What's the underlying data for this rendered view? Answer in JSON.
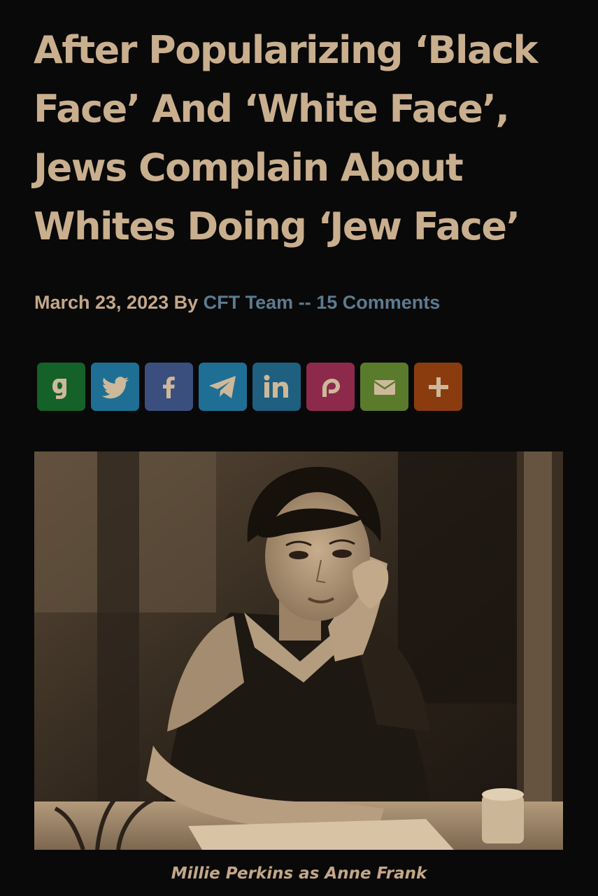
{
  "article": {
    "title": "After Popularizing ‘Black Face’ And ‘White Face’, Jews Complain About Whites Doing ‘Jew Face’",
    "date": "March 23, 2023",
    "by_label": "By",
    "author": "CFT Team",
    "separator": "--",
    "comments_link": "15 Comments"
  },
  "share_buttons": [
    {
      "network": "gab",
      "icon": "gab-icon",
      "color": "#14612a"
    },
    {
      "network": "twitter",
      "icon": "twitter-icon",
      "color": "#1f6f95"
    },
    {
      "network": "facebook",
      "icon": "facebook-icon",
      "color": "#3b4f7e"
    },
    {
      "network": "telegram",
      "icon": "telegram-icon",
      "color": "#1f6f95"
    },
    {
      "network": "linkedin",
      "icon": "linkedin-icon",
      "color": "#1f5f80"
    },
    {
      "network": "parler",
      "icon": "parler-icon",
      "color": "#8d2a4c"
    },
    {
      "network": "email",
      "icon": "email-icon",
      "color": "#5a7b2c"
    },
    {
      "network": "more",
      "icon": "plus-icon",
      "color": "#8a3c0e"
    }
  ],
  "figure": {
    "caption": "Millie Perkins as Anne Frank"
  },
  "colors": {
    "background": "#0a0909",
    "title": "#c9af8e",
    "meta_text": "#c3a789",
    "link": "#5c7b90"
  }
}
